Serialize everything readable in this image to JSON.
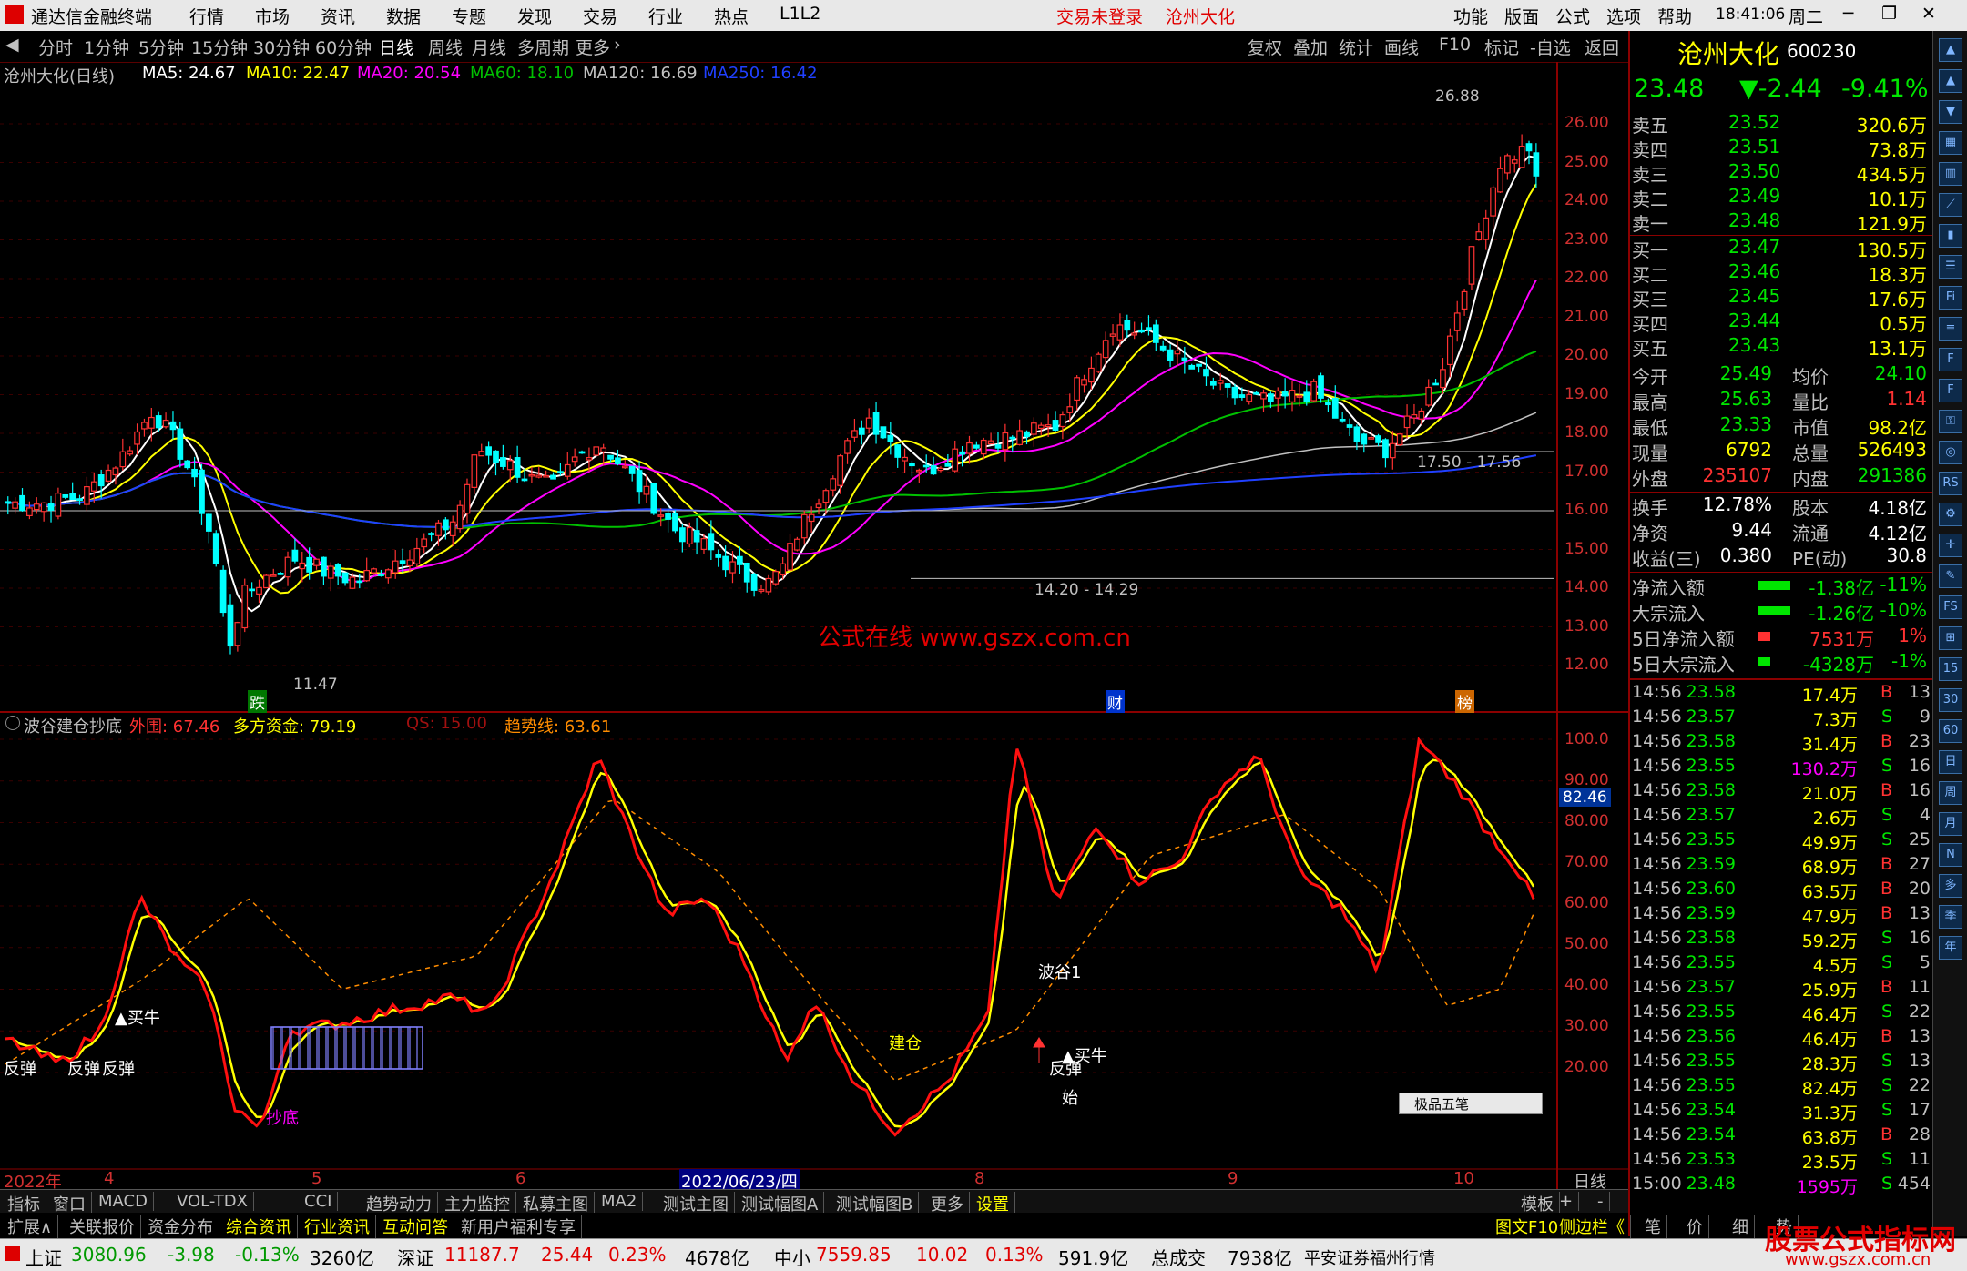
{
  "titlebar": {
    "app_name": "通达信金融终端",
    "menus": [
      "行情",
      "市场",
      "资讯",
      "数据",
      "专题",
      "发现",
      "交易",
      "行业",
      "热点",
      "L1L2"
    ],
    "status_warn": "交易未登录",
    "stock_title": "沧州大化",
    "right_menus": [
      "功能",
      "版面",
      "公式",
      "选项",
      "帮助"
    ],
    "time": "18:41:06",
    "weekday": "周二"
  },
  "periods": {
    "items": [
      "分时",
      "1分钟",
      "5分钟",
      "15分钟",
      "30分钟",
      "60分钟",
      "日线",
      "周线",
      "月线",
      "多周期",
      "更多"
    ],
    "active": "日线",
    "right_items": [
      "复权",
      "叠加",
      "统计",
      "画线",
      "F10",
      "标记",
      "-自选",
      "返回"
    ]
  },
  "main_info": {
    "stock": "沧州大化(日线)",
    "ma5": "MA5: 24.67",
    "ma10": "MA10: 22.47",
    "ma20": "MA20: 20.54",
    "ma60": "MA60: 18.10",
    "ma120": "MA120: 16.69",
    "ma250": "MA250: 16.42"
  },
  "main_axis": [
    "26.00",
    "25.00",
    "24.00",
    "23.00",
    "22.00",
    "21.00",
    "20.00",
    "19.00",
    "18.00",
    "17.00",
    "16.00",
    "15.00",
    "14.00",
    "13.00",
    "12.00"
  ],
  "main_annotations": {
    "high": "26.88",
    "low": "11.47",
    "mid_range": "14.20 - 14.29",
    "right_range": "17.50 - 17.56",
    "watermark": "公式在线  www.gszx.com.cn",
    "marker_die": "跌",
    "marker_cai": "财",
    "marker_bang": "榜"
  },
  "sub_info": {
    "name": "波谷建仓抄底",
    "waiwei": "外围: 67.46",
    "duofang": "多方资金: 79.19",
    "qs": "QS: 15.00",
    "qushi": "趋势线: 63.61"
  },
  "sub_axis": [
    "100.0",
    "90.00",
    "80.00",
    "70.00",
    "60.00",
    "50.00",
    "40.00",
    "30.00",
    "20.00"
  ],
  "sub_current": "82.46",
  "sub_labels": {
    "fantan": "反弹",
    "maiNiu": "▲买牛",
    "chaodi": "抄底",
    "jiancang": "建仓",
    "bogu": "波谷1",
    "shi": "始",
    "jipin": "极品五笔"
  },
  "date_axis": {
    "year": "2022年",
    "months": [
      "4",
      "5",
      "6",
      "8",
      "9",
      "10"
    ],
    "highlight": "2022/06/23/四",
    "period": "日线"
  },
  "quote": {
    "name": "沧州大化",
    "code": "600230",
    "price": "23.48",
    "change": "▼-2.44",
    "pct": "-9.41%",
    "asks": [
      {
        "label": "卖五",
        "price": "23.52",
        "vol": "320.6万"
      },
      {
        "label": "卖四",
        "price": "23.51",
        "vol": "73.8万"
      },
      {
        "label": "卖三",
        "price": "23.50",
        "vol": "434.5万"
      },
      {
        "label": "卖二",
        "price": "23.49",
        "vol": "10.1万"
      },
      {
        "label": "卖一",
        "price": "23.48",
        "vol": "121.9万"
      }
    ],
    "bids": [
      {
        "label": "买一",
        "price": "23.47",
        "vol": "130.5万"
      },
      {
        "label": "买二",
        "price": "23.46",
        "vol": "18.3万"
      },
      {
        "label": "买三",
        "price": "23.45",
        "vol": "17.6万"
      },
      {
        "label": "买四",
        "price": "23.44",
        "vol": "0.5万"
      },
      {
        "label": "买五",
        "price": "23.43",
        "vol": "13.1万"
      }
    ],
    "stats": [
      {
        "l1": "今开",
        "v1": "25.49",
        "l2": "均价",
        "v2": "24.10"
      },
      {
        "l1": "最高",
        "v1": "25.63",
        "l2": "量比",
        "v2": "1.14"
      },
      {
        "l1": "最低",
        "v1": "23.33",
        "l2": "市值",
        "v2": "98.2亿"
      },
      {
        "l1": "现量",
        "v1": "6792",
        "l2": "总量",
        "v2": "526493"
      },
      {
        "l1": "外盘",
        "v1": "235107",
        "l2": "内盘",
        "v2": "291386"
      }
    ],
    "stats2": [
      {
        "l1": "换手",
        "v1": "12.78%",
        "l2": "股本",
        "v2": "4.18亿"
      },
      {
        "l1": "净资",
        "v1": "9.44",
        "l2": "流通",
        "v2": "4.12亿"
      },
      {
        "l1": "收益(三)",
        "v1": "0.380",
        "l2": "PE(动)",
        "v2": "30.8"
      }
    ],
    "flows": [
      {
        "label": "净流入额",
        "val": "-1.38亿",
        "pct": "-11%",
        "color": "#00e600"
      },
      {
        "label": "大宗流入",
        "val": "-1.26亿",
        "pct": "-10%",
        "color": "#00e600"
      },
      {
        "label": "5日净流入额",
        "val": "7531万",
        "pct": "1%",
        "color": "#ff3232"
      },
      {
        "label": "5日大宗流入",
        "val": "-4328万",
        "pct": "-1%",
        "color": "#00e600"
      }
    ]
  },
  "ticks": [
    {
      "t": "14:56",
      "p": "23.58",
      "v": "17.4万",
      "d": "B",
      "n": "13"
    },
    {
      "t": "14:56",
      "p": "23.57",
      "v": "7.3万",
      "d": "S",
      "n": "9"
    },
    {
      "t": "14:56",
      "p": "23.58",
      "v": "31.4万",
      "d": "B",
      "n": "23"
    },
    {
      "t": "14:56",
      "p": "23.55",
      "v": "130.2万",
      "d": "S",
      "n": "16"
    },
    {
      "t": "14:56",
      "p": "23.58",
      "v": "21.0万",
      "d": "B",
      "n": "16"
    },
    {
      "t": "14:56",
      "p": "23.57",
      "v": "2.6万",
      "d": "S",
      "n": "4"
    },
    {
      "t": "14:56",
      "p": "23.55",
      "v": "49.9万",
      "d": "S",
      "n": "25"
    },
    {
      "t": "14:56",
      "p": "23.59",
      "v": "68.9万",
      "d": "B",
      "n": "27"
    },
    {
      "t": "14:56",
      "p": "23.60",
      "v": "63.5万",
      "d": "B",
      "n": "20"
    },
    {
      "t": "14:56",
      "p": "23.59",
      "v": "47.9万",
      "d": "B",
      "n": "13"
    },
    {
      "t": "14:56",
      "p": "23.58",
      "v": "59.2万",
      "d": "S",
      "n": "16"
    },
    {
      "t": "14:56",
      "p": "23.55",
      "v": "4.5万",
      "d": "S",
      "n": "5"
    },
    {
      "t": "14:56",
      "p": "23.57",
      "v": "25.9万",
      "d": "B",
      "n": "11"
    },
    {
      "t": "14:56",
      "p": "23.55",
      "v": "46.4万",
      "d": "S",
      "n": "22"
    },
    {
      "t": "14:56",
      "p": "23.56",
      "v": "46.4万",
      "d": "B",
      "n": "13"
    },
    {
      "t": "14:56",
      "p": "23.55",
      "v": "28.3万",
      "d": "S",
      "n": "13"
    },
    {
      "t": "14:56",
      "p": "23.55",
      "v": "82.4万",
      "d": "S",
      "n": "22"
    },
    {
      "t": "14:56",
      "p": "23.54",
      "v": "31.3万",
      "d": "S",
      "n": "17"
    },
    {
      "t": "14:56",
      "p": "23.54",
      "v": "63.8万",
      "d": "B",
      "n": "28"
    },
    {
      "t": "14:56",
      "p": "23.53",
      "v": "23.5万",
      "d": "S",
      "n": "11"
    },
    {
      "t": "15:00",
      "p": "23.48",
      "v": "1595万",
      "d": "S",
      "n": "454"
    }
  ],
  "side_icons": [
    "up-arrow-icon",
    "up-arrow-icon",
    "down-arrow-icon",
    "chart-icon",
    "bars-icon",
    "line-icon",
    "candle-icon",
    "list-icon",
    "fin-icon",
    "list2-icon",
    "f2-icon",
    "f3-icon",
    "lock-icon",
    "circle-icon",
    "rsi-icon",
    "gear-icon",
    "cross-icon",
    "pencil-icon",
    "fs-icon",
    "glyph-icon",
    "num15",
    "num30",
    "num60",
    "日",
    "周",
    "月",
    "N",
    "多",
    "季",
    "年"
  ],
  "bottom_tabs": [
    "指标",
    "窗口",
    "MACD",
    "VOL-TDX",
    "CCI",
    "趋势动力",
    "主力监控",
    "私募主图",
    "MA2",
    "测试主图",
    "测试幅图A",
    "测试幅图B",
    "更多",
    "设置",
    "模板",
    "+",
    "-"
  ],
  "bottom_tabs2": [
    "扩展∧",
    "关联报价",
    "资金分布",
    "综合资讯",
    "行业资讯",
    "互动问答",
    "新用户福利专享"
  ],
  "bottom_tabs2_right": [
    "图文F10",
    "侧边栏《",
    "笔",
    "价",
    "细",
    "势"
  ],
  "statusbar": {
    "sh_name": "上证",
    "sh_val": "3080.96",
    "sh_chg": "-3.98",
    "sh_pct": "-0.13%",
    "sh_amt": "3260亿",
    "sz_name": "深证",
    "sz_val": "11187.7",
    "sz_chg": "25.44",
    "sz_pct": "0.23%",
    "sz_amt": "4678亿",
    "zx_name": "中小",
    "zx_val": "7559.85",
    "zx_chg": "10.02",
    "zx_pct": "0.13%",
    "zx_amt": "591.9亿",
    "total_label": "总成交",
    "total_val": "7938亿",
    "broker": "平安证券福州行情",
    "logo": "股票公式指标网",
    "logo_url": "www.gszx.com.cn"
  },
  "colors": {
    "up": "#ff3232",
    "down": "#00ffff",
    "ma5": "#ffffff",
    "ma10": "#ffff00",
    "ma20": "#ff00ff",
    "ma60": "#00c000",
    "ma120": "#c0c0c0",
    "ma250": "#2040ff"
  }
}
